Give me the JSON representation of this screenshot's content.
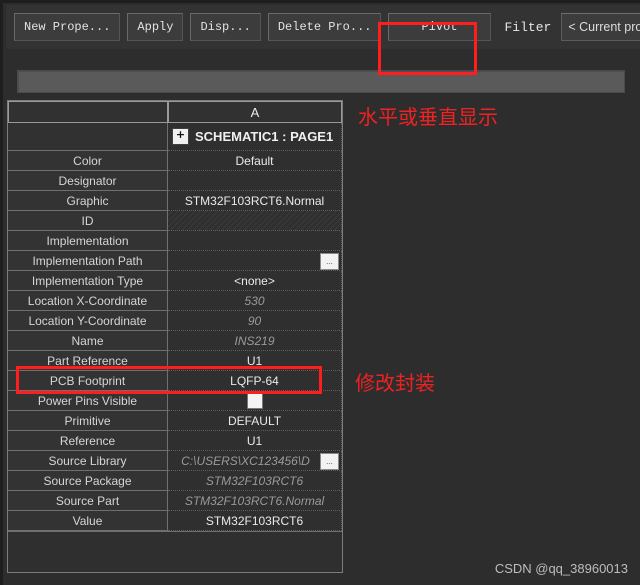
{
  "toolbar": {
    "buttons": [
      {
        "label": "New Prope...",
        "name": "new-property-button"
      },
      {
        "label": "Apply",
        "name": "apply-button"
      },
      {
        "label": "Disp...",
        "name": "display-button"
      },
      {
        "label": "Delete Pro...",
        "name": "delete-property-button"
      },
      {
        "label": "Pivot",
        "name": "pivot-button"
      }
    ],
    "filter_label": "Filter",
    "filter_value": "< Current prope"
  },
  "filter_input": {
    "value": "",
    "placeholder": ""
  },
  "annotations": {
    "orientation_note": "水平或垂直显示",
    "footprint_note": "修改封装"
  },
  "grid": {
    "corner_header": "",
    "column_header": "A",
    "page_row": {
      "expand_icon": "+",
      "label": "SCHEMATIC1 : PAGE1"
    },
    "browse_label": "...",
    "rows": [
      {
        "name": "Color",
        "value": "Default",
        "style": "normal"
      },
      {
        "name": "Designator",
        "value": "",
        "style": "normal"
      },
      {
        "name": "Graphic",
        "value": "STM32F103RCT6.Normal",
        "style": "normal"
      },
      {
        "name": "ID",
        "value": "",
        "style": "hatched"
      },
      {
        "name": "Implementation",
        "value": "",
        "style": "normal"
      },
      {
        "name": "Implementation Path",
        "value": "",
        "style": "browse"
      },
      {
        "name": "Implementation Type",
        "value": "<none>",
        "style": "normal"
      },
      {
        "name": "Location X-Coordinate",
        "value": "530",
        "style": "readonly"
      },
      {
        "name": "Location Y-Coordinate",
        "value": "90",
        "style": "readonly"
      },
      {
        "name": "Name",
        "value": "INS219",
        "style": "readonly"
      },
      {
        "name": "Part Reference",
        "value": "U1",
        "style": "normal"
      },
      {
        "name": "PCB Footprint",
        "value": "LQFP-64",
        "style": "normal"
      },
      {
        "name": "Power Pins Visible",
        "value": "",
        "style": "checkbox"
      },
      {
        "name": "Primitive",
        "value": "DEFAULT",
        "style": "normal"
      },
      {
        "name": "Reference",
        "value": "U1",
        "style": "normal"
      },
      {
        "name": "Source Library",
        "value": "C:\\USERS\\XC123456\\D",
        "style": "browse-readonly"
      },
      {
        "name": "Source Package",
        "value": "STM32F103RCT6",
        "style": "readonly"
      },
      {
        "name": "Source Part",
        "value": "STM32F103RCT6.Normal",
        "style": "readonly"
      },
      {
        "name": "Value",
        "value": "STM32F103RCT6",
        "style": "normal"
      }
    ]
  },
  "watermark": "CSDN @qq_38960013"
}
